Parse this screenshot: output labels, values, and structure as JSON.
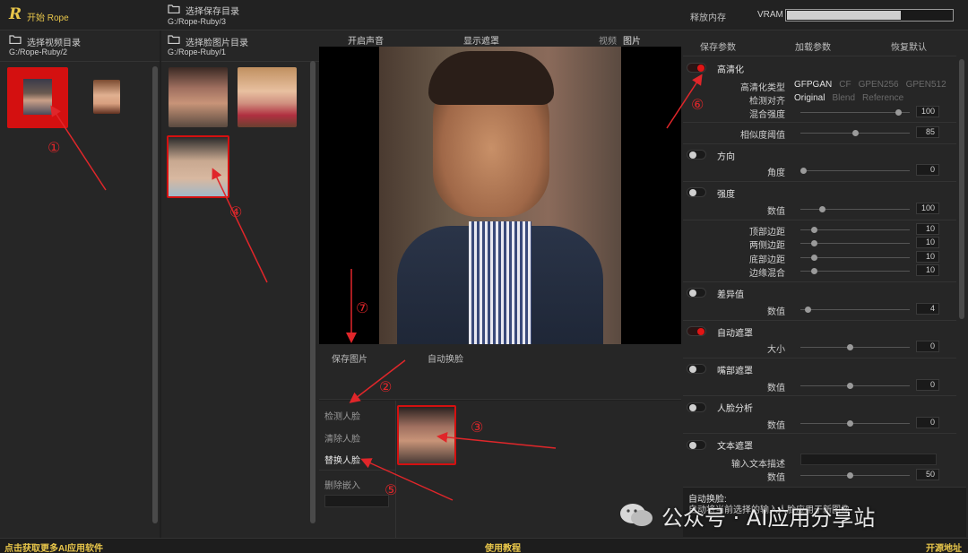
{
  "titlebar": {
    "logo": "R",
    "start": "开始 Rope",
    "save_dir_label": "选择保存目录",
    "save_dir_path": "G:/Rope-Ruby/3",
    "release_mem": "释放内存",
    "vram": "VRAM",
    "vram_fill_fraction": 0.69
  },
  "video_panel": {
    "title": "选择视频目录",
    "path": "G:/Rope-Ruby/2"
  },
  "face_panel": {
    "title": "选择脸图片目录",
    "path": "G:/Rope-Ruby/1"
  },
  "preview_tabs": {
    "audio": "开启声音",
    "mask": "显示遮罩",
    "video": "视频",
    "image": "图片"
  },
  "preview_actions": {
    "save_image": "保存图片",
    "auto_swap": "自动换脸"
  },
  "face_actions": {
    "detect": "检测人脸",
    "clear": "清除人脸",
    "swap": "替换人脸",
    "delete_embed": "删除嵌入"
  },
  "right_actions": {
    "save_params": "保存参数",
    "load_params": "加载参数",
    "restore_default": "恢复默认"
  },
  "options": {
    "enhance": {
      "title": "高清化",
      "type_label": "高清化类型",
      "types": [
        "GFPGAN",
        "CF",
        "GPEN256",
        "GPEN512"
      ],
      "align_label": "检测对齐",
      "aligns": [
        "Original",
        "Blend",
        "Reference"
      ],
      "blend_label": "混合强度",
      "blend_value": "100",
      "blend_frac": 0.92
    },
    "similarity": {
      "label": "相似度阈值",
      "value": "85",
      "frac": 0.5
    },
    "orientation": {
      "title": "方向",
      "label": "角度",
      "value": "0",
      "frac": 0.0
    },
    "strength": {
      "title": "强度",
      "label": "数值",
      "value": "100",
      "frac": 0.18
    },
    "borders": {
      "top_label": "顶部边距",
      "top_value": "10",
      "side_label": "两侧边距",
      "side_value": "10",
      "bottom_label": "底部边距",
      "bottom_value": "10",
      "blend_label": "边缘混合",
      "blend_value": "10",
      "frac": 0.1
    },
    "diff": {
      "title": "差异值",
      "label": "数值",
      "value": "4",
      "frac": 0.04
    },
    "auto_mask": {
      "title": "自动遮罩",
      "label": "大小",
      "value": "0",
      "frac": 0.45
    },
    "mouth_mask": {
      "title": "嘴部遮罩",
      "label": "数值",
      "value": "0",
      "frac": 0.45
    },
    "face_parse": {
      "title": "人脸分析",
      "label": "数值",
      "value": "0",
      "frac": 0.45
    },
    "text_mask": {
      "title": "文本遮罩",
      "desc_label": "输入文本描述",
      "label": "数值",
      "value": "50",
      "frac": 0.45
    }
  },
  "info": {
    "title": "自动换脸:",
    "desc": "自动将当前选择的输入人脸应用于新图像"
  },
  "watermark": "公众号 · AI应用分享站",
  "footer": {
    "left": "点击获取更多AI应用软件",
    "center": "使用教程",
    "right": "开源地址"
  },
  "annotations": [
    "①",
    "②",
    "③",
    "④",
    "⑤",
    "⑥",
    "⑦"
  ],
  "colors": {
    "accent_red": "#e01515",
    "annotation_red": "#e0262a",
    "bg": "#202020",
    "gold": "#e8c64a"
  }
}
